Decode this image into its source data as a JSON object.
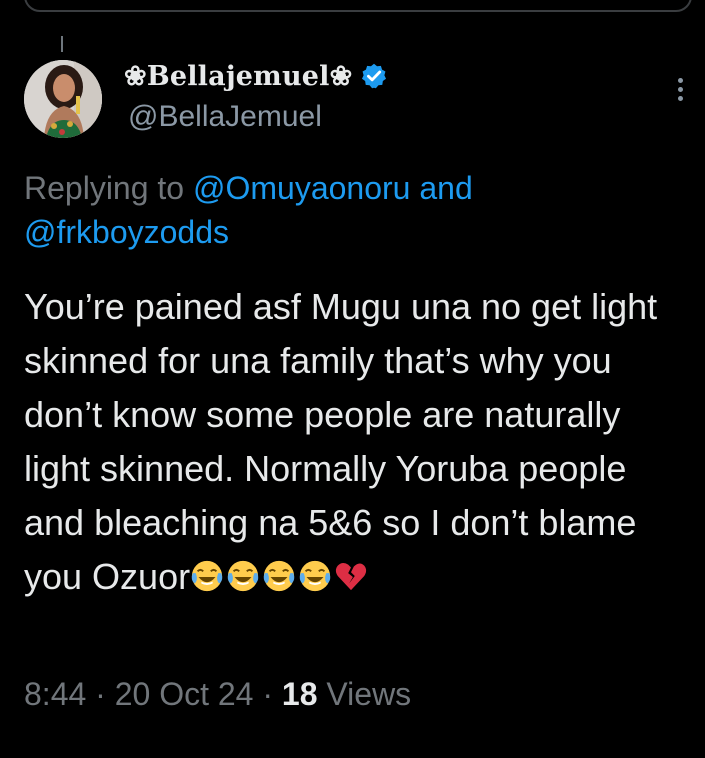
{
  "author": {
    "display_name": "❀Bellajemuel❀",
    "handle": "@BellaJemuel",
    "verified": true
  },
  "reply": {
    "prefix": "Replying to",
    "mentions": [
      "@Omuyaonoru",
      "@frkboyzodds"
    ],
    "joiner": "and"
  },
  "tweet": {
    "text": "You’re pained asf Mugu una no get light skinned for una family that’s why you don’t know some people are naturally light skinned. Normally Yoruba people and bleaching na 5&6 so I don’t blame you Ozuor",
    "emojis": [
      "face-with-tears-of-joy",
      "face-with-tears-of-joy",
      "face-with-tears-of-joy",
      "face-with-tears-of-joy",
      "broken-heart"
    ]
  },
  "meta": {
    "time": "8:44",
    "date": "20 Oct 24",
    "views_count": "18",
    "views_label": "Views",
    "separator": "·"
  },
  "colors": {
    "background": "#000000",
    "text": "#e7e9ea",
    "secondary": "#71767b",
    "link": "#1d9bf0",
    "verified": "#1d9bf0"
  }
}
